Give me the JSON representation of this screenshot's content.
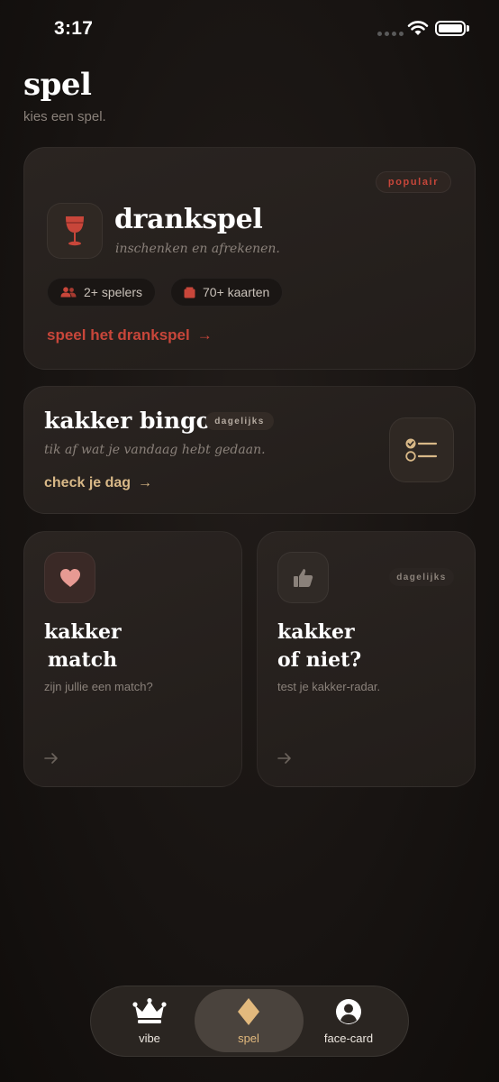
{
  "status_bar": {
    "time": "3:17"
  },
  "header": {
    "title": "spel",
    "subtitle": "kies een spel."
  },
  "drankspel_card": {
    "badge": "populair",
    "title": "drankspel",
    "subtitle": "inschenken en afrekenen.",
    "players_chip": "2+ spelers",
    "cards_chip": "70+ kaarten",
    "cta": "speel het drankspel",
    "cta_arrow": "→"
  },
  "bingo_card": {
    "title": "kakker bingo",
    "badge": "dagelijks",
    "subtitle": "tik af wat je vandaag hebt gedaan.",
    "cta": "check je dag",
    "cta_arrow": "→"
  },
  "match_card": {
    "title_line1": "kakker",
    "title_line2": "match",
    "subtitle": "zijn jullie een match?",
    "arrow": "→"
  },
  "niet_card": {
    "badge": "dagelijks",
    "title_line1": "kakker",
    "title_line2": "of niet?",
    "subtitle": "test je kakker-radar.",
    "arrow": "→"
  },
  "tab_bar": {
    "tabs": [
      {
        "label": "vibe",
        "icon": "crown-icon"
      },
      {
        "label": "spel",
        "icon": "diamond-icon",
        "active": true
      },
      {
        "label": "face-card",
        "icon": "user-icon"
      }
    ]
  },
  "colors": {
    "accent_red": "#c8463a",
    "accent_gold": "#d8b887",
    "active_tab": "#e2b97d",
    "background": "#181412"
  }
}
